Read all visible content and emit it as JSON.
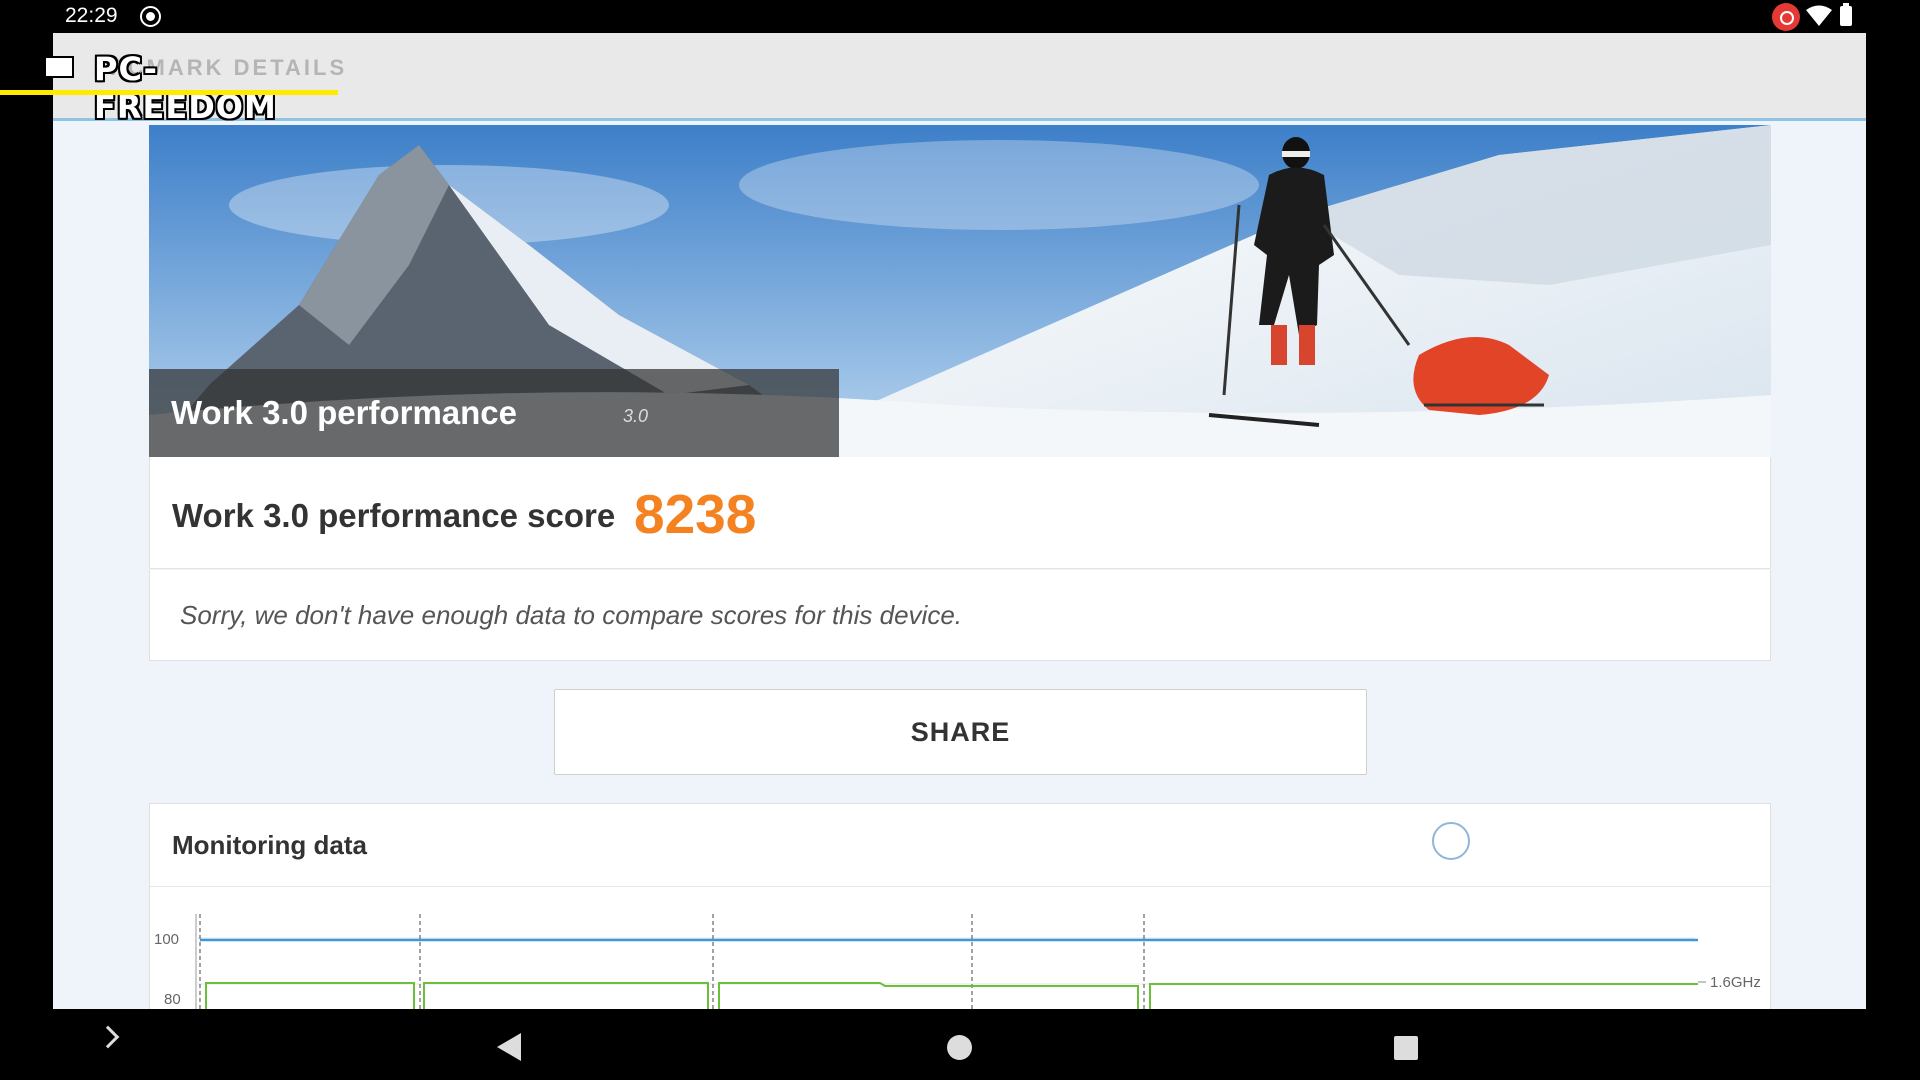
{
  "status_bar": {
    "time": "22:29",
    "icons": [
      "screen-record-icon",
      "cast-icon",
      "wifi-icon",
      "battery-icon"
    ]
  },
  "topbar": {
    "title": "PCMARK DETAILS"
  },
  "watermark": {
    "text": "PC-FREEDOM"
  },
  "hero": {
    "title": "Work 3.0 performance",
    "version": "3.0"
  },
  "score": {
    "label": "Work 3.0 performance score",
    "value": "8238",
    "color": "#f58220"
  },
  "compare": {
    "message": "Sorry, we don't have enough data to compare scores for this device."
  },
  "share": {
    "label": "SHARE"
  },
  "monitoring": {
    "title": "Monitoring data",
    "y_ticks": [
      "100",
      "80"
    ],
    "freq_label": "1.6GHz",
    "series_colors": {
      "battery": "#3a9ad9",
      "cpu_freq": "#6cbf3a"
    }
  },
  "navbar": {
    "buttons": [
      "expand-icon",
      "back-icon",
      "home-icon",
      "recents-icon"
    ]
  }
}
